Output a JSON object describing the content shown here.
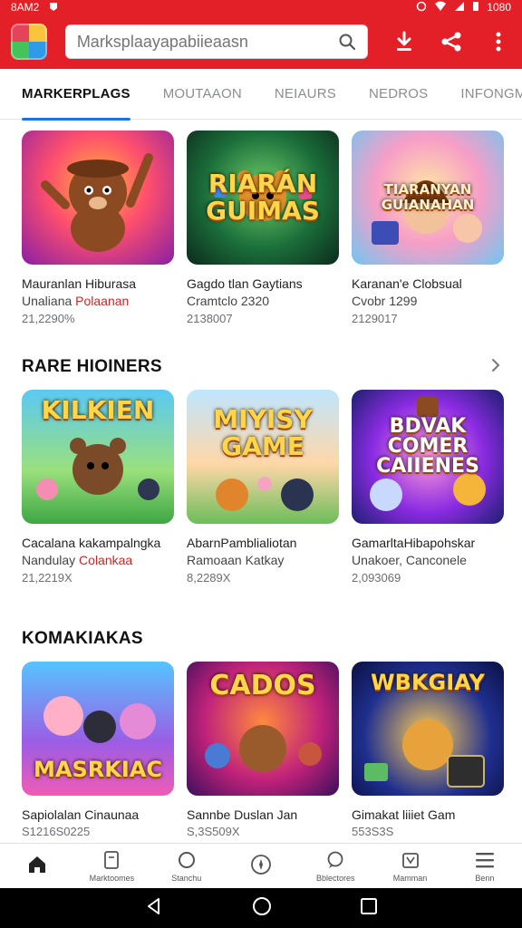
{
  "status": {
    "time": "8AM2",
    "battery": "1080"
  },
  "app": {
    "search_placeholder": "Marksplaayapabiieaasn"
  },
  "tabs": [
    {
      "label": "MARKERPLAGS",
      "active": true
    },
    {
      "label": "MOUTAAON",
      "active": false
    },
    {
      "label": "NEIAURS",
      "active": false
    },
    {
      "label": "NEDROS",
      "active": false
    },
    {
      "label": "INFONGMS",
      "active": false
    }
  ],
  "sections": [
    {
      "title": "",
      "items": [
        {
          "art_text": "",
          "title": "Mauranlan Hiburasa",
          "sub": "Unaliana ",
          "accent": "Polaanan",
          "meta": "21,2290%"
        },
        {
          "art_text": "RIARÁN GUIMAS",
          "title": "Gagdo tlan Gaytians",
          "sub": "Cramtclo 2320",
          "accent": "",
          "meta": "2138007"
        },
        {
          "art_text": "TIARANYAN GUIANAHAN",
          "title": "Karanan'e Clobsual",
          "sub": "Cvobr 1299",
          "accent": "",
          "meta": "2129017"
        }
      ]
    },
    {
      "title": "RARE HIOINERS",
      "items": [
        {
          "art_text": "KILKIEN",
          "title": "Cacalana kakampalngka",
          "sub": "Nandulay ",
          "accent": "Colankaa",
          "meta": "21,2219X"
        },
        {
          "art_text": "MIYISY GAME",
          "title": "AbarnPamblialiotan",
          "sub": "Ramoaan Katkay",
          "accent": "",
          "meta": "8,2289X"
        },
        {
          "art_text": "BDVAK COMER CAIIENES",
          "title": "GamarltaHibapohskar",
          "sub": "Unakoer, Canconele",
          "accent": "",
          "meta": "2,093069"
        }
      ]
    },
    {
      "title": "KOMAKIAKAS",
      "items": [
        {
          "art_text": "MASRKIAC",
          "title": "Sapiolalan Cinaunaa",
          "sub": "",
          "accent": "",
          "meta": "S1216S0225"
        },
        {
          "art_text": "CADOS",
          "title": "Sannbe Duslan Jan",
          "sub": "",
          "accent": "",
          "meta": "S,3S509X"
        },
        {
          "art_text": "WBKGIAY",
          "title": "Gimakat liiiet Gam",
          "sub": "",
          "accent": "",
          "meta": "553S3S"
        }
      ]
    }
  ],
  "bottom_nav": [
    {
      "label": "",
      "icon": "home-icon"
    },
    {
      "label": "Marktoomes",
      "icon": "document-icon"
    },
    {
      "label": "Stanchu",
      "icon": "circle-icon"
    },
    {
      "label": "",
      "icon": "compass-icon"
    },
    {
      "label": "Bblectores",
      "icon": "chat-icon"
    },
    {
      "label": "Mamman",
      "icon": "shopping-icon"
    },
    {
      "label": "Benn",
      "icon": "menu-icon"
    }
  ],
  "colors": {
    "brand": "#e32027",
    "tab_indicator": "#1a73e8",
    "accent_text": "#c62828"
  }
}
